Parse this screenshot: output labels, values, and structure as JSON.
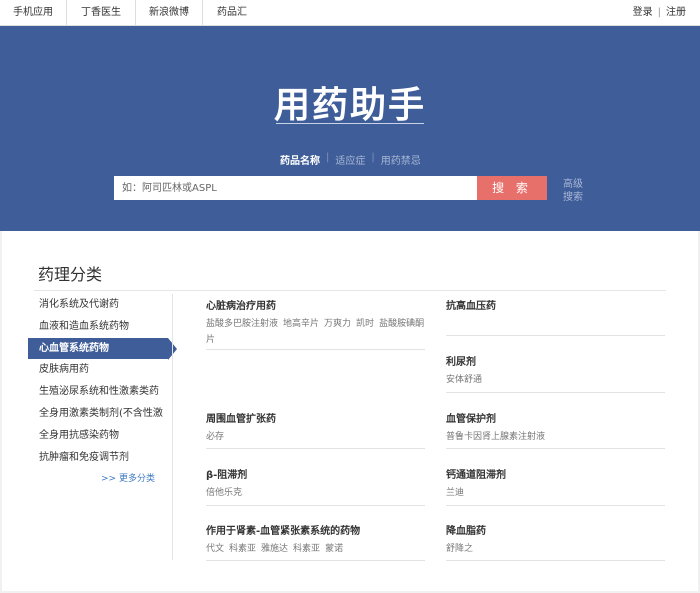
{
  "topnav": [
    "手机应用",
    "丁香医生",
    "新浪微博",
    "药品汇"
  ],
  "user": {
    "login": "登录",
    "separator": "|",
    "register": "注册"
  },
  "hero": {
    "title": "用药助手",
    "search_tabs": [
      "药品名称",
      "适应症",
      "用药禁忌"
    ],
    "tab_separator": "|",
    "search_placeholder": "如：阿司匹林或ASPL",
    "search_button": "搜 索",
    "advanced_search": "高级搜索"
  },
  "section": {
    "title": "药理分类",
    "sidebar": [
      "消化系统及代谢药",
      "血液和造血系统药物",
      "心血管系统药物",
      "皮肤病用药",
      "生殖泌尿系统和性激素类药",
      "全身用激素类制剂(不含性激",
      "全身用抗感染药物",
      "抗肿瘤和免疫调节剂"
    ],
    "active_index": 2,
    "more": ">> 更多分类"
  },
  "categories": [
    {
      "name": "心脏病治疗用药",
      "drugs": [
        "盐酸多巴胺注射液",
        "地高辛片",
        "万爽力",
        "凯时",
        "盐酸胺碘酮片"
      ]
    },
    {
      "name": "抗高血压药",
      "drugs": []
    },
    {
      "name": "利尿剂",
      "drugs": [
        "安体舒通"
      ]
    },
    {
      "name": "周围血管扩张药",
      "drugs": [
        "必存"
      ]
    },
    {
      "name": "血管保护剂",
      "drugs": [
        "普鲁卡因肾上腺素注射液"
      ]
    },
    {
      "name": "β-阻滞剂",
      "drugs": [
        "倍他乐克"
      ]
    },
    {
      "name": "钙通道阻滞剂",
      "drugs": [
        "兰迪"
      ]
    },
    {
      "name": "作用于肾素-血管紧张素系统的药物",
      "drugs": [
        "代文",
        "科素亚",
        "雅施达",
        "科素亚",
        "蒙诺"
      ]
    },
    {
      "name": "降血脂药",
      "drugs": [
        "舒降之"
      ]
    }
  ]
}
